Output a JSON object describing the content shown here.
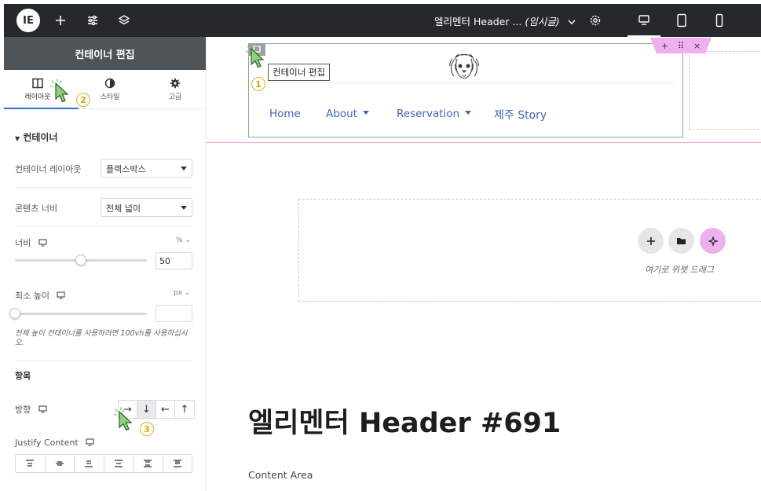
{
  "topbar": {
    "logo_text": "IE",
    "doc_title": "엘리멘터 Header ...",
    "doc_status": "(임시글)",
    "icons": [
      "plus-icon",
      "sliders-icon",
      "layers-icon",
      "chevron-down-icon",
      "gear-icon",
      "desktop-icon",
      "tablet-icon",
      "mobile-icon"
    ]
  },
  "sidebar": {
    "header": "컨테이너 편집",
    "tabs": [
      {
        "label": "레이아웃",
        "icon": "layout-icon"
      },
      {
        "label": "스타일",
        "icon": "contrast-icon"
      },
      {
        "label": "고급",
        "icon": "gear-icon"
      }
    ],
    "active_tab": "레이아웃",
    "section_title": "컨테이너",
    "container_layout": {
      "label": "컨테이너 레이아웃",
      "value": "플렉스박스"
    },
    "content_width": {
      "label": "콘텐츠 너비",
      "value": "전체 넓이"
    },
    "width": {
      "label": "너비",
      "unit": "%",
      "value": "50",
      "slider_fraction": 0.5
    },
    "min_height": {
      "label": "최소 높이",
      "unit": "px",
      "value": "",
      "slider_fraction": 0
    },
    "help_text": "전체 높이 컨테이너를 사용하려면 100vh를 사용하십시오.",
    "items_title": "항목",
    "direction": {
      "label": "방향",
      "options": [
        "→",
        "↓",
        "←",
        "↑"
      ],
      "active": "↓"
    },
    "justify": {
      "label": "Justify Content"
    }
  },
  "canvas": {
    "tooltip": "컨테이너 편집",
    "nav": [
      {
        "label": "Home",
        "dropdown": false
      },
      {
        "label": "About",
        "dropdown": true
      },
      {
        "label": "Reservation",
        "dropdown": true
      },
      {
        "label": "제주 Story",
        "dropdown": false
      }
    ],
    "toolbar": [
      "+",
      "⠿",
      "×"
    ],
    "drop_text": "여기로 위젯 드래그",
    "page_title": "엘리멘터 Header #691",
    "content_area": "Content Area"
  },
  "annotations": [
    {
      "number": "1"
    },
    {
      "number": "2"
    },
    {
      "number": "3"
    }
  ],
  "colors": {
    "topbar": "#26292c",
    "sidebar_header": "#4f5459",
    "accent": "#2f6fd6",
    "nav_link": "#3f67b3",
    "pink": "#f0b0f0",
    "badge": "#e1b11a",
    "cursor": "#86c77a"
  }
}
